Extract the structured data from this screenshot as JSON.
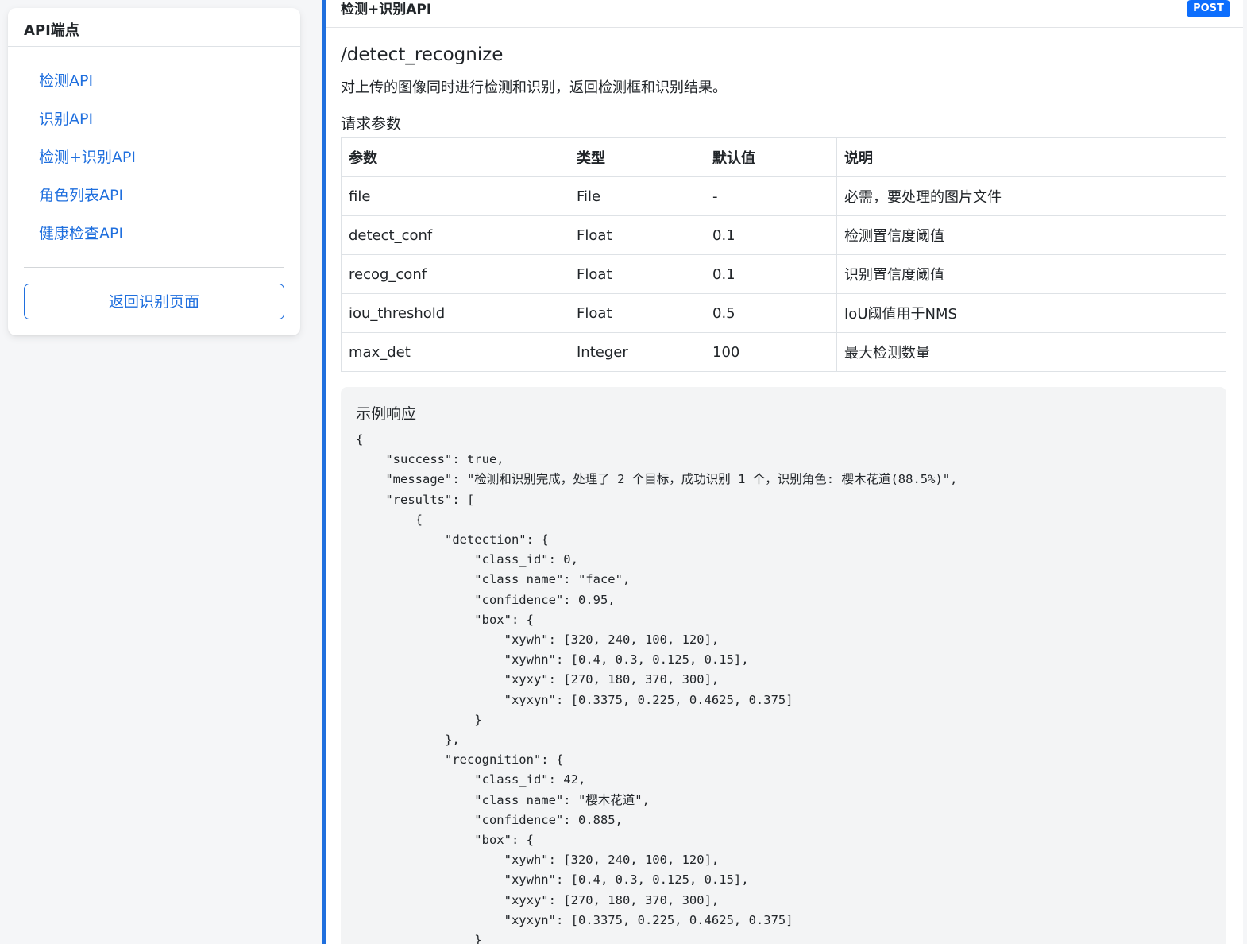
{
  "sidebar": {
    "title": "API端点",
    "items": [
      {
        "label": "检测API"
      },
      {
        "label": "识别API"
      },
      {
        "label": "检测+识别API"
      },
      {
        "label": "角色列表API"
      },
      {
        "label": "健康检查API"
      }
    ],
    "back_button": "返回识别页面"
  },
  "endpoint": {
    "title": "检测+识别API",
    "method": "POST",
    "path": "/detect_recognize",
    "description": "对上传的图像同时进行检测和识别，返回检测框和识别结果。",
    "params_title": "请求参数",
    "table": {
      "headers": [
        "参数",
        "类型",
        "默认值",
        "说明"
      ],
      "rows": [
        [
          "file",
          "File",
          "-",
          "必需，要处理的图片文件"
        ],
        [
          "detect_conf",
          "Float",
          "0.1",
          "检测置信度阈值"
        ],
        [
          "recog_conf",
          "Float",
          "0.1",
          "识别置信度阈值"
        ],
        [
          "iou_threshold",
          "Float",
          "0.5",
          "IoU阈值用于NMS"
        ],
        [
          "max_det",
          "Integer",
          "100",
          "最大检测数量"
        ]
      ]
    },
    "response_title": "示例响应",
    "response_code": "{\n    \"success\": true,\n    \"message\": \"检测和识别完成，处理了 2 个目标，成功识别 1 个，识别角色: 樱木花道(88.5%)\",\n    \"results\": [\n        {\n            \"detection\": {\n                \"class_id\": 0,\n                \"class_name\": \"face\",\n                \"confidence\": 0.95,\n                \"box\": {\n                    \"xywh\": [320, 240, 100, 120],\n                    \"xywhn\": [0.4, 0.3, 0.125, 0.15],\n                    \"xyxy\": [270, 180, 370, 300],\n                    \"xyxyn\": [0.3375, 0.225, 0.4625, 0.375]\n                }\n            },\n            \"recognition\": {\n                \"class_id\": 42,\n                \"class_name\": \"樱木花道\",\n                \"confidence\": 0.885,\n                \"box\": {\n                    \"xywh\": [320, 240, 100, 120],\n                    \"xywhn\": [0.4, 0.3, 0.125, 0.15],\n                    \"xyxy\": [270, 180, 370, 300],\n                    \"xyxyn\": [0.3375, 0.225, 0.4625, 0.375]\n                }"
  },
  "colors": {
    "accent": "#1f6fde",
    "badge": "#0d6efd",
    "page_bg": "#f5f6f8",
    "code_bg": "#f3f4f5"
  }
}
